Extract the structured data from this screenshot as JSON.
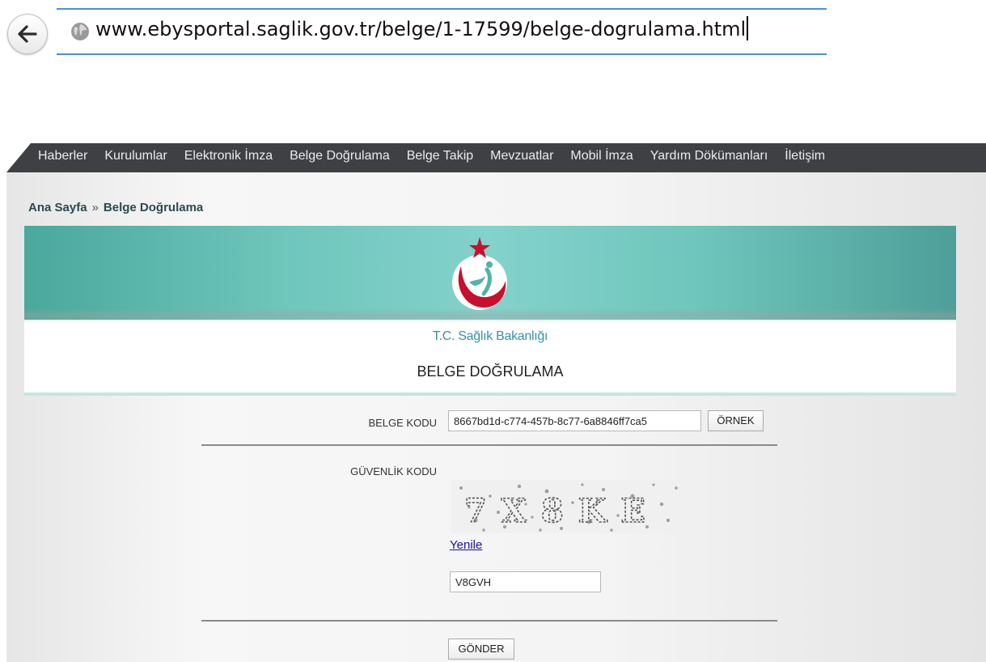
{
  "browser": {
    "url": "www.ebysportal.saglik.gov.tr/belge/1-17599/belge-dogrulama.html",
    "back_icon": "back-arrow-icon",
    "site_icon": "globe-icon"
  },
  "nav": {
    "items": [
      {
        "label": "Haberler"
      },
      {
        "label": "Kurulumlar"
      },
      {
        "label": "Elektronik İmza"
      },
      {
        "label": "Belge Doğrulama"
      },
      {
        "label": "Belge Takip"
      },
      {
        "label": "Mevzuatlar"
      },
      {
        "label": "Mobil İmza"
      },
      {
        "label": "Yardım Dökümanları"
      },
      {
        "label": "İletişim"
      }
    ]
  },
  "breadcrumb": {
    "home": "Ana Sayfa",
    "separator": "»",
    "current": "Belge Doğrulama"
  },
  "banner": {
    "ministry": "T.C. Sağlık Bakanlığı",
    "title": "BELGE DOĞRULAMA",
    "logo_icon": "ministry-of-health-logo",
    "colors": {
      "teal": "#6fc6bb",
      "crescent": "#c8102e"
    }
  },
  "form": {
    "document_code_label": "BELGE KODU",
    "document_code_value": "8667bd1d-c774-457b-8c77-6a8846ff7ca5",
    "example_button": "ÖRNEK",
    "security_code_label": "GÜVENLİK KODU",
    "captcha_text": "7X8KE",
    "refresh_link": "Yenile",
    "security_code_value": "V8GVH",
    "submit_button": "GÖNDER"
  }
}
